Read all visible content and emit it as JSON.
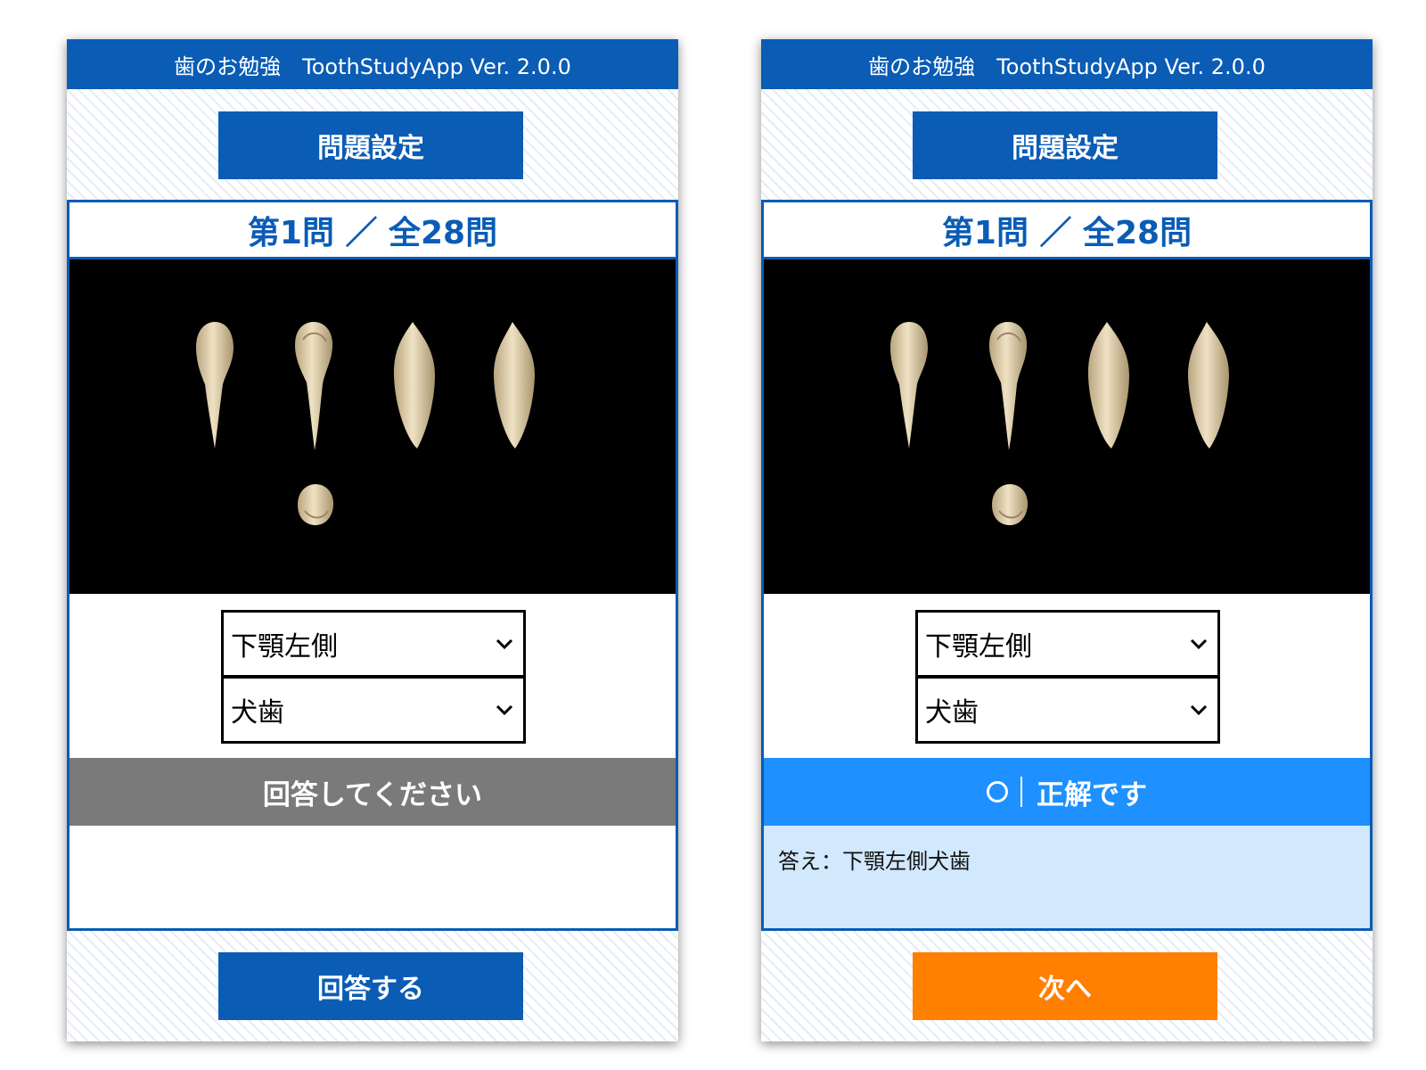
{
  "colors": {
    "header_blue": "#0a5cb5",
    "status_pending": "#7a7a7a",
    "status_correct": "#1e90ff",
    "answer_bg": "#d2e8fc",
    "next_orange": "#ff7f00",
    "tooth_color": "#e7d7b4"
  },
  "screens": [
    {
      "header_title": "歯のお勉強　ToothStudyApp Ver. 2.0.0",
      "settings_label": "問題設定",
      "question_counter": "第1問 ／ 全28問",
      "tooth_views": [
        "labial-view",
        "mesial-view",
        "lingual-view",
        "distal-view",
        "incisal-view"
      ],
      "select_jaw": {
        "value": "下顎左側",
        "icon": "chevron-down-icon"
      },
      "select_tooth": {
        "value": "犬歯",
        "icon": "chevron-down-icon"
      },
      "status": {
        "text": "回答してください",
        "state": "pending"
      },
      "answer_text": "",
      "bottom_button_label": "回答する"
    },
    {
      "header_title": "歯のお勉強　ToothStudyApp Ver. 2.0.0",
      "settings_label": "問題設定",
      "question_counter": "第1問 ／ 全28問",
      "tooth_views": [
        "labial-view",
        "mesial-view",
        "lingual-view",
        "distal-view",
        "incisal-view"
      ],
      "select_jaw": {
        "value": "下顎左側",
        "icon": "chevron-down-icon"
      },
      "select_tooth": {
        "value": "犬歯",
        "icon": "chevron-down-icon"
      },
      "status": {
        "text": "正解です",
        "state": "correct",
        "icon": "circle-correct-icon"
      },
      "answer_text": "答え：下顎左側犬歯",
      "bottom_button_label": "次へ"
    }
  ]
}
